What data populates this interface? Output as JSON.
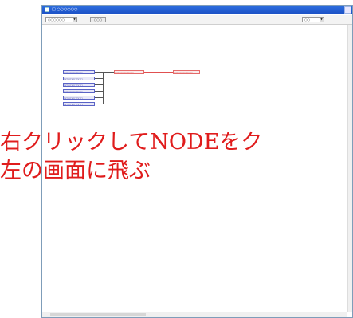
{
  "window": {
    "title": "□ ○○○○○○",
    "toolbar": {
      "combo_left_label": "○○○○○○",
      "button_label": "○○○",
      "combo_right_label": "○○"
    }
  },
  "graph": {
    "left_nodes": [
      {
        "label": "○○○○○○○○○"
      },
      {
        "label": "○○○○○○○○○"
      },
      {
        "label": "○○○○○○○○○"
      },
      {
        "label": "○○○○○○○○○"
      },
      {
        "label": "○○○○○○○○○"
      },
      {
        "label": "○○○○○○○○○"
      }
    ],
    "red_nodes": [
      {
        "label": "○○○○○○○○○"
      },
      {
        "label": "○○○○○○○○○"
      }
    ]
  },
  "annotation": {
    "line1": "右クリックしてNODEをク",
    "line2": "左の画面に飛ぶ"
  },
  "colors": {
    "titlebar": "#1a4fc4",
    "node_blue": "#5a63c6",
    "node_red": "#e46a6a",
    "annotation": "#e01c1c"
  }
}
